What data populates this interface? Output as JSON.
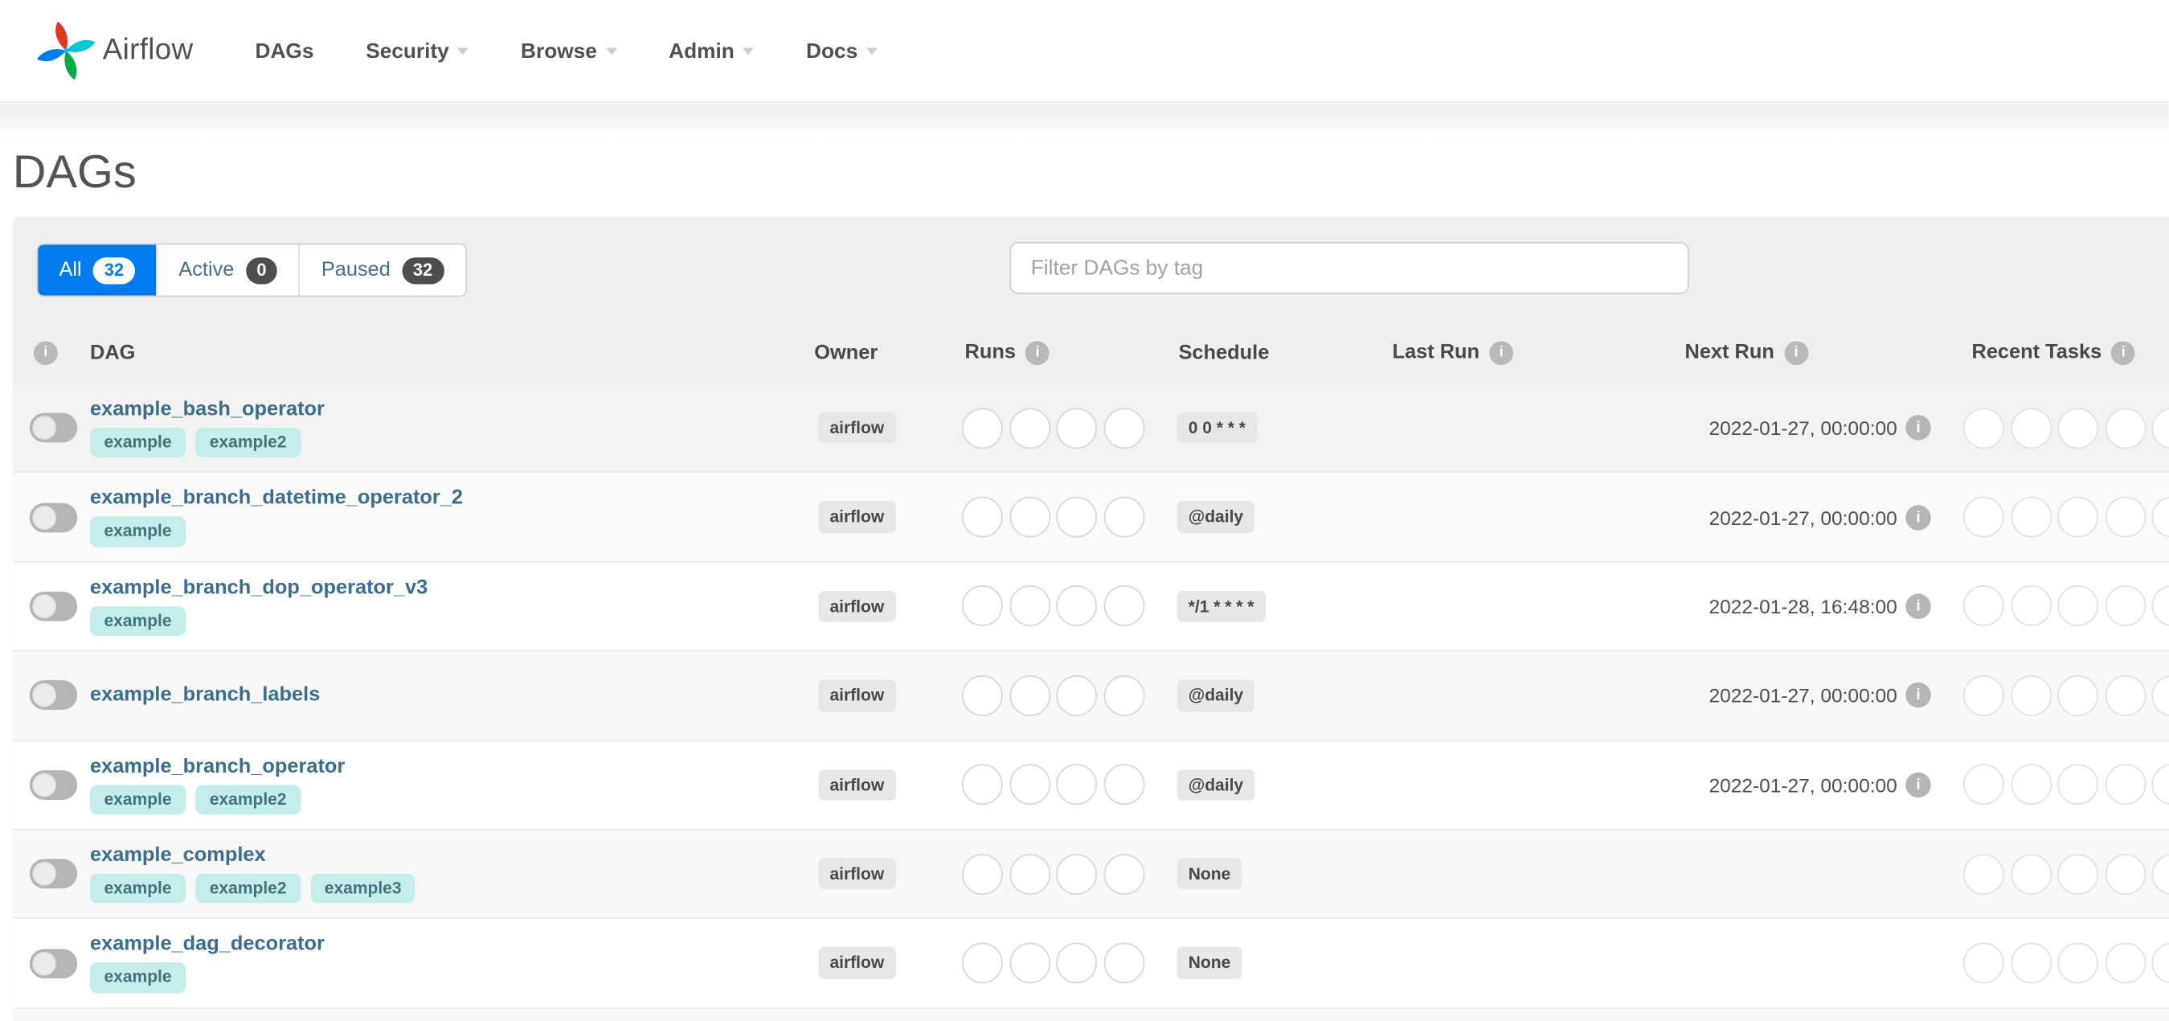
{
  "nav": {
    "brand": "Airflow",
    "items": [
      {
        "label": "DAGs",
        "caret": false
      },
      {
        "label": "Security",
        "caret": true
      },
      {
        "label": "Browse",
        "caret": true
      },
      {
        "label": "Admin",
        "caret": true
      },
      {
        "label": "Docs",
        "caret": true
      }
    ]
  },
  "page": {
    "title": "DAGs"
  },
  "filters": {
    "tabs": [
      {
        "label": "All",
        "count": "32",
        "active": true
      },
      {
        "label": "Active",
        "count": "0",
        "active": false
      },
      {
        "label": "Paused",
        "count": "32",
        "active": false
      }
    ]
  },
  "search": {
    "placeholder": "Filter DAGs by tag"
  },
  "icons": {
    "info": "i"
  },
  "colors": {
    "accent": "#017cee",
    "link": "#3a6d92",
    "tag_bg": "#c3eeeb",
    "tag_text": "#41747c",
    "badge_bg": "#e7e7e7"
  },
  "table": {
    "columns": [
      {
        "label": "DAG"
      },
      {
        "label": "Owner"
      },
      {
        "label": "Runs"
      },
      {
        "label": "Schedule"
      },
      {
        "label": "Last Run"
      },
      {
        "label": "Next Run"
      },
      {
        "label": "Recent Tasks"
      }
    ],
    "runs_circle_count": 4,
    "recent_circle_count": 5,
    "rows": [
      {
        "name": "example_bash_operator",
        "tags": [
          "example",
          "example2"
        ],
        "owner": "airflow",
        "schedule": "0 0 * * *",
        "last_run": "",
        "next_run": "2022-01-27, 00:00:00"
      },
      {
        "name": "example_branch_datetime_operator_2",
        "tags": [
          "example"
        ],
        "owner": "airflow",
        "schedule": "@daily",
        "last_run": "",
        "next_run": "2022-01-27, 00:00:00"
      },
      {
        "name": "example_branch_dop_operator_v3",
        "tags": [
          "example"
        ],
        "owner": "airflow",
        "schedule": "*/1 * * * *",
        "last_run": "",
        "next_run": "2022-01-28, 16:48:00"
      },
      {
        "name": "example_branch_labels",
        "tags": [],
        "owner": "airflow",
        "schedule": "@daily",
        "last_run": "",
        "next_run": "2022-01-27, 00:00:00"
      },
      {
        "name": "example_branch_operator",
        "tags": [
          "example",
          "example2"
        ],
        "owner": "airflow",
        "schedule": "@daily",
        "last_run": "",
        "next_run": "2022-01-27, 00:00:00"
      },
      {
        "name": "example_complex",
        "tags": [
          "example",
          "example2",
          "example3"
        ],
        "owner": "airflow",
        "schedule": "None",
        "last_run": "",
        "next_run": ""
      },
      {
        "name": "example_dag_decorator",
        "tags": [
          "example"
        ],
        "owner": "airflow",
        "schedule": "None",
        "last_run": "",
        "next_run": ""
      }
    ]
  }
}
